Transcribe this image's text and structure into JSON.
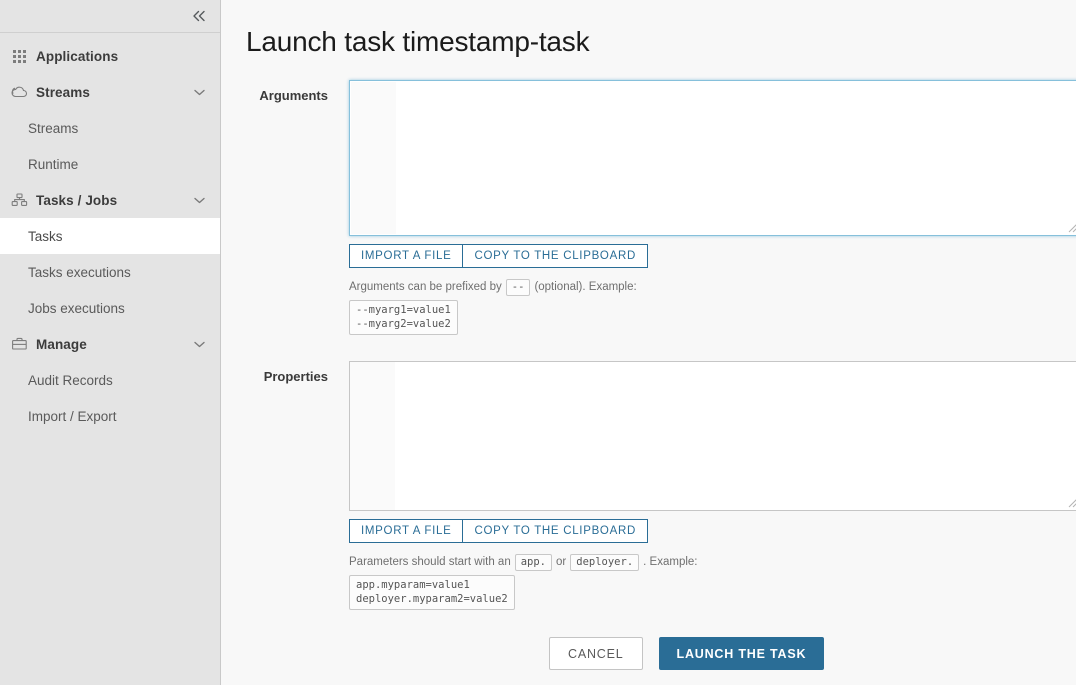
{
  "sidebar": {
    "collapse_icon": "double-chevron-left",
    "groups": [
      {
        "label": "Applications",
        "icon": "grid-icon",
        "has_chevron": false,
        "items": []
      },
      {
        "label": "Streams",
        "icon": "cloud-icon",
        "has_chevron": true,
        "chevron": "chevron-down-icon",
        "items": [
          {
            "label": "Streams",
            "active": false
          },
          {
            "label": "Runtime",
            "active": false
          }
        ]
      },
      {
        "label": "Tasks / Jobs",
        "icon": "tasks-icon",
        "has_chevron": true,
        "chevron": "chevron-down-icon",
        "items": [
          {
            "label": "Tasks",
            "active": true
          },
          {
            "label": "Tasks executions",
            "active": false
          },
          {
            "label": "Jobs executions",
            "active": false
          }
        ]
      },
      {
        "label": "Manage",
        "icon": "briefcase-icon",
        "has_chevron": true,
        "chevron": "chevron-down-icon",
        "items": [
          {
            "label": "Audit Records",
            "active": false
          },
          {
            "label": "Import / Export",
            "active": false
          }
        ]
      }
    ]
  },
  "page": {
    "title": "Launch task timestamp-task"
  },
  "arguments": {
    "label": "Arguments",
    "value": "",
    "focused": true,
    "import_label": "IMPORT A FILE",
    "copy_label": "COPY TO THE CLIPBOARD",
    "hint_before": "Arguments can be prefixed by",
    "hint_chip": "--",
    "hint_after": "(optional). Example:",
    "example": "--myarg1=value1\n--myarg2=value2"
  },
  "properties": {
    "label": "Properties",
    "value": "",
    "focused": false,
    "import_label": "IMPORT A FILE",
    "copy_label": "COPY TO THE CLIPBOARD",
    "hint_before": "Parameters should start with an",
    "hint_chip1": "app.",
    "hint_mid": "or",
    "hint_chip2": "deployer.",
    "hint_after": ". Example:",
    "example": "app.myparam=value1\ndeployer.myparam2=value2"
  },
  "actions": {
    "cancel_label": "CANCEL",
    "launch_label": "LAUNCH THE TASK"
  },
  "colors": {
    "accent": "#2a6d96",
    "sidebar_bg": "#e4e4e4",
    "content_bg": "#f8f8f8",
    "focus_border": "#86c0db"
  }
}
